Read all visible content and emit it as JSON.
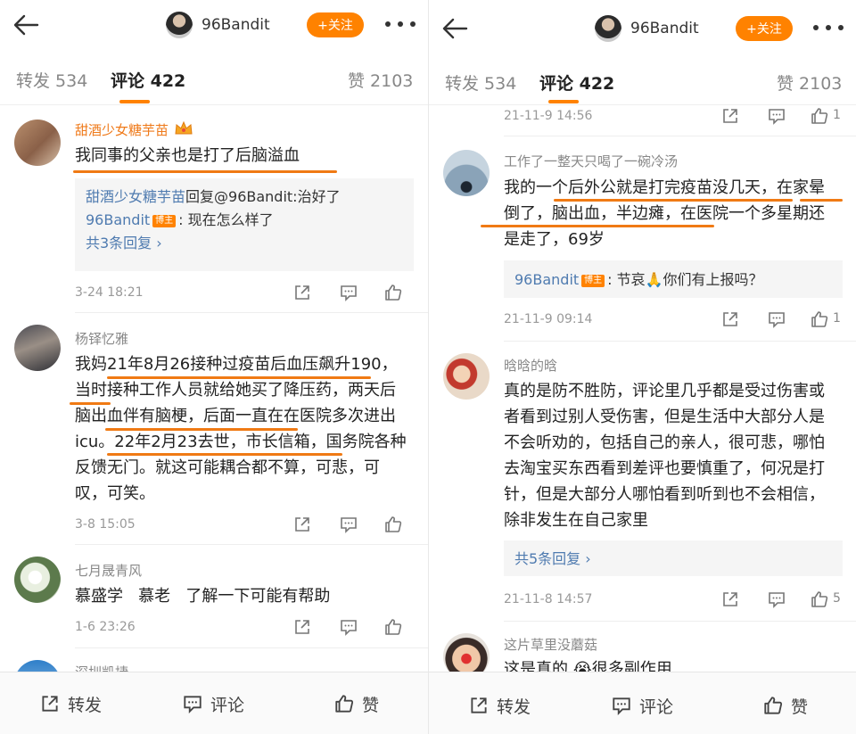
{
  "left": {
    "header": {
      "username": "96Bandit",
      "follow_label": "+关注"
    },
    "tabs": {
      "repost": "转发 534",
      "comment": "评论 422",
      "like": "赞 2103"
    },
    "comments": [
      {
        "name": "甜酒少女糖芋苗",
        "text": "我同事的父亲也是打了后脑溢血",
        "replies": [
          {
            "user": "甜酒少女糖芋苗",
            "text": "回复@96Bandit:治好了"
          },
          {
            "user": "96Bandit",
            "badge": "博主",
            "text": ": 现在怎么样了"
          }
        ],
        "more": "共3条回复",
        "time": "3-24 18:21"
      },
      {
        "name": "杨铎忆雅",
        "text": "我妈21年8月26接种过疫苗后血压飙升190，当时接种工作人员就给她买了降压药，两天后脑出血伴有脑梗，后面一直在在医院多次进出icu。22年2月23去世，市长信箱，国务院各种反馈无门。就这可能耦合都不算，可悲，可叹，可笑。",
        "time": "3-8 15:05"
      },
      {
        "name": "七月晟青风",
        "text": "慕盛学   慕老   了解一下可能有帮助",
        "time": "1-6 23:26"
      },
      {
        "name": "深圳凯捷"
      }
    ],
    "bottom": {
      "repost": "转发",
      "comment": "评论",
      "like": "赞"
    }
  },
  "right": {
    "header": {
      "username": "96Bandit",
      "follow_label": "+关注"
    },
    "tabs": {
      "repost": "转发 534",
      "comment": "评论 422",
      "like": "赞 2103"
    },
    "top_time": "21-11-9 14:56",
    "top_like": "1",
    "comments": [
      {
        "name": "工作了一整天只喝了一碗冷汤",
        "text": "我的一个后外公就是打完疫苗没几天，在家晕倒了，脑出血，半边瘫，在医院一个多星期还是走了，69岁",
        "reply_user": "96Bandit",
        "reply_badge": "博主",
        "reply_text": ": 节哀🙏你们有上报吗？",
        "time": "21-11-9 09:14",
        "likes": "1"
      },
      {
        "name": "晗晗的晗",
        "text": "真的是防不胜防，评论里几乎都是受过伤害或者看到过别人受伤害，但是生活中大部分人是不会听劝的，包括自己的亲人，很可悲，哪怕去淘宝买东西看到差评也要慎重了，何况是打针，但是大部分人哪怕看到听到也不会相信，除非发生在自己家里",
        "more": "共5条回复",
        "time": "21-11-8 14:57",
        "likes": "5"
      },
      {
        "name": "这片草里没蘑菇",
        "text": "这是真的 😭很多副作用"
      }
    ],
    "bottom": {
      "repost": "转发",
      "comment": "评论",
      "like": "赞"
    }
  },
  "icons": [
    "back-arrow-icon",
    "more-dots-icon",
    "share-icon",
    "comment-icon",
    "like-icon",
    "chevron-right-icon",
    "crown-icon"
  ],
  "colors": {
    "accent": "#ff8200",
    "link": "#4f7bb0",
    "username_vip": "#ef7a1a",
    "underline": "#f07a14"
  }
}
